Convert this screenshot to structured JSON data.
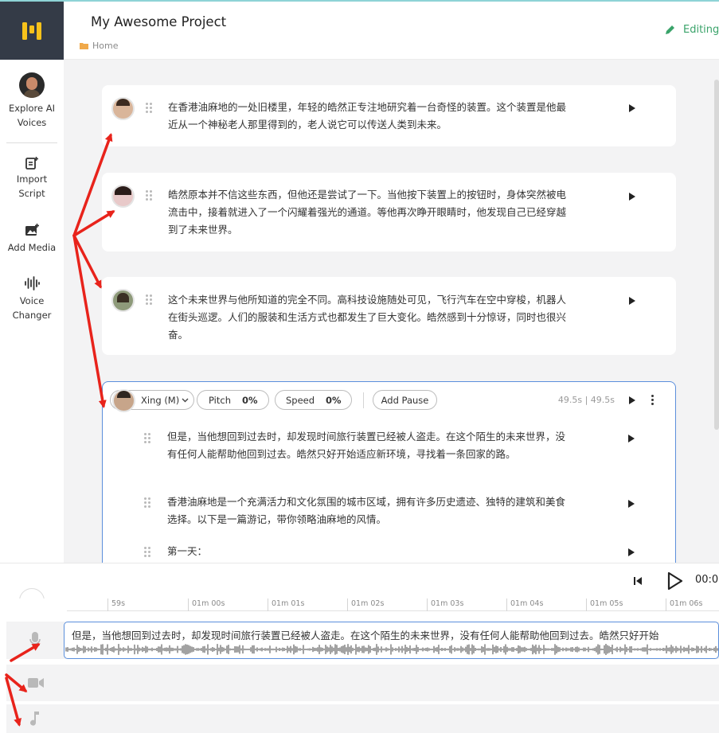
{
  "app": {
    "title": "My Awesome Project",
    "breadcrumb": "Home",
    "status": "Editing"
  },
  "sidebar": {
    "items": [
      {
        "label": "Explore AI Voices",
        "icon": "avatar-icon"
      },
      {
        "label": "Import Script",
        "icon": "import-script-icon"
      },
      {
        "label": "Add Media",
        "icon": "add-media-icon"
      },
      {
        "label": "Voice Changer",
        "icon": "voice-changer-icon"
      }
    ]
  },
  "paragraphs": [
    {
      "text": "在香港油麻地的一处旧楼里，年轻的皓然正专注地研究着一台奇怪的装置。这个装置是他最近从一个神秘老人那里得到的，老人说它可以传送人类到未来。"
    },
    {
      "text": "皓然原本并不信这些东西，但他还是尝试了一下。当他按下装置上的按钮时，身体突然被电流击中，接着就进入了一个闪耀着强光的通道。等他再次睁开眼睛时，他发现自己已经穿越到了未来世界。"
    },
    {
      "text": "这个未来世界与他所知道的完全不同。高科技设施随处可见，飞行汽车在空中穿梭，机器人在街头巡逻。人们的服装和生活方式也都发生了巨大变化。皓然感到十分惊讶，同时也很兴奋。"
    }
  ],
  "active_block": {
    "voice": "Xing (M)",
    "pitch_label": "Pitch",
    "pitch_value": "0%",
    "speed_label": "Speed",
    "speed_value": "0%",
    "add_pause": "Add Pause",
    "duration": "49.5s | 49.5s",
    "lines": [
      {
        "text": "但是，当他想回到过去时，却发现时间旅行装置已经被人盗走。在这个陌生的未来世界，没有任何人能帮助他回到过去。皓然只好开始适应新环境，寻找着一条回家的路。"
      },
      {
        "text": "香港油麻地是一个充满活力和文化氛围的城市区域，拥有许多历史遗迹、独特的建筑和美食选择。以下是一篇游记，带你领略油麻地的风情。"
      },
      {
        "text": "第一天："
      }
    ]
  },
  "player": {
    "time": "00:0"
  },
  "timeline": {
    "ticks": [
      "59s",
      "01m 00s",
      "01m 01s",
      "01m 02s",
      "01m 03s",
      "01m 04s",
      "01m 05s",
      "01m 06s"
    ],
    "clip_text": "但是，当他想回到过去时，却发现时间旅行装置已经被人盗走。在这个陌生的未来世界，没有任何人能帮助他回到过去。皓然只好开始",
    "tracks": [
      {
        "icon": "microphone-icon"
      },
      {
        "icon": "video-camera-icon"
      },
      {
        "icon": "music-note-icon"
      }
    ]
  },
  "colors": {
    "accent": "#5b8fdc",
    "editing": "#3aa36a",
    "annotation": "#e8231b",
    "logo_bg": "#343b47",
    "logo_fg": "#f7c21b"
  }
}
